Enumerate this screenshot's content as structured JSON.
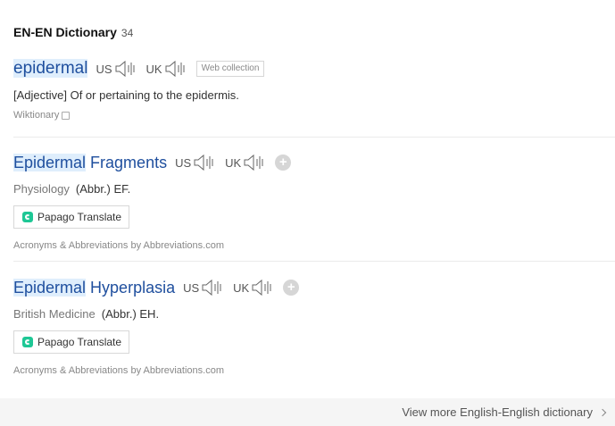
{
  "header": {
    "title": "EN-EN Dictionary",
    "count": "34"
  },
  "entries": [
    {
      "headword_hl": "epidermal",
      "headword_rest": "",
      "us_label": "US",
      "uk_label": "UK",
      "tag": "Web collection",
      "definition": "[Adjective] Of or pertaining to the epidermis.",
      "source": "Wiktionary"
    },
    {
      "headword_hl": "Epidermal",
      "headword_rest": " Fragments",
      "us_label": "US",
      "uk_label": "UK",
      "add": "+",
      "field": "Physiology",
      "meaning": "(Abbr.) EF.",
      "papago": "Papago Translate",
      "attribution": "Acronyms & Abbreviations by Abbreviations.com"
    },
    {
      "headword_hl": "Epidermal",
      "headword_rest": " Hyperplasia",
      "us_label": "US",
      "uk_label": "UK",
      "add": "+",
      "field": "British Medicine",
      "meaning": "(Abbr.) EH.",
      "papago": "Papago Translate",
      "attribution": "Acronyms & Abbreviations by Abbreviations.com"
    }
  ],
  "footer": {
    "more_link": "View more English-English dictionary"
  },
  "icons": {
    "speaker": "speaker-icon",
    "copy": "copy-icon",
    "papago": "papago-logo-icon",
    "chevron": "chevron-right-icon",
    "add": "plus-circle-icon"
  },
  "colors": {
    "link": "#1f4f9e",
    "highlight": "#dfeefc",
    "papago": "#1ec795"
  }
}
